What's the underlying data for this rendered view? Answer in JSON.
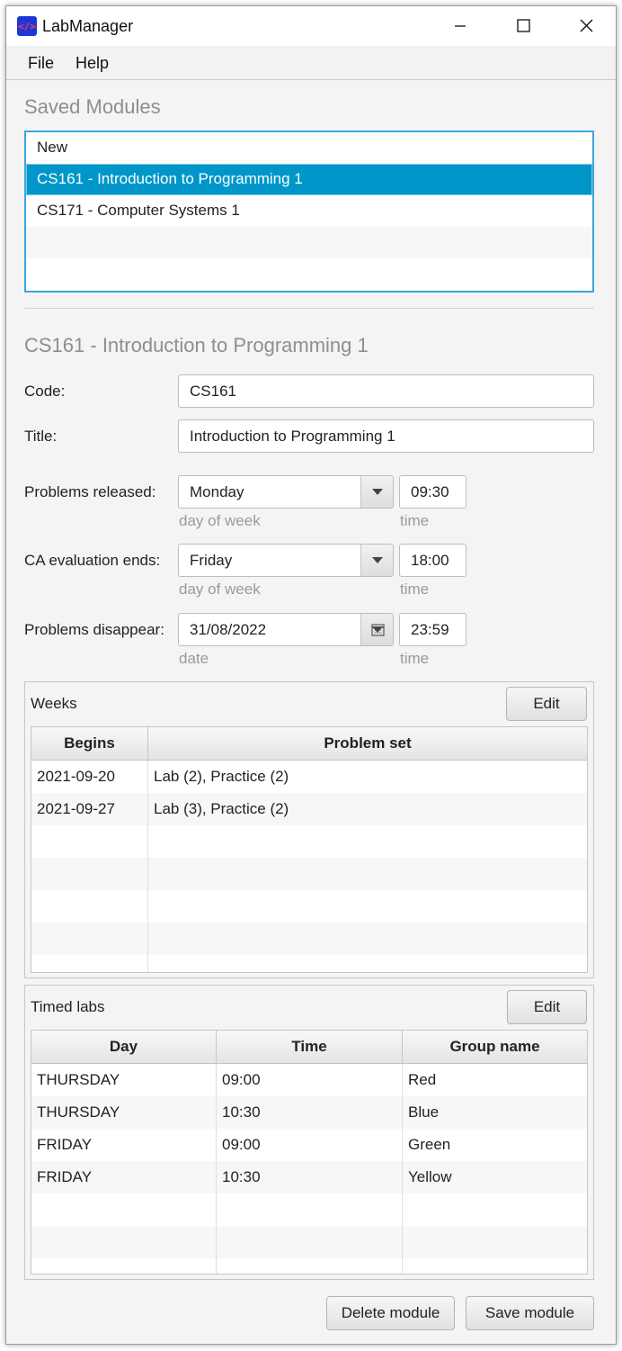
{
  "window": {
    "title": "LabManager",
    "app_icon": "code-brackets-icon"
  },
  "menu": {
    "items": [
      "File",
      "Help"
    ]
  },
  "saved_modules": {
    "heading": "Saved Modules",
    "items": [
      "New",
      "CS161 - Introduction to Programming 1",
      "CS171 - Computer Systems 1",
      "",
      ""
    ],
    "selected_index": 1
  },
  "module": {
    "heading": "CS161 - Introduction to Programming 1",
    "code_label": "Code:",
    "code_value": "CS161",
    "title_label": "Title:",
    "title_value": "Introduction to Programming 1",
    "released_label": "Problems released:",
    "released_day": "Monday",
    "released_time": "09:30",
    "ca_label": "CA evaluation ends:",
    "ca_day": "Friday",
    "ca_time": "18:00",
    "disappear_label": "Problems disappear:",
    "disappear_date": "31/08/2022",
    "disappear_time": "23:59",
    "hint_day": "day of week",
    "hint_time": "time",
    "hint_date": "date"
  },
  "weeks": {
    "title": "Weeks",
    "edit_label": "Edit",
    "columns": [
      "Begins",
      "Problem set"
    ],
    "rows": [
      [
        "2021-09-20",
        "Lab (2), Practice (2)"
      ],
      [
        "2021-09-27",
        "Lab (3), Practice (2)"
      ],
      [
        "",
        ""
      ],
      [
        "",
        ""
      ],
      [
        "",
        ""
      ],
      [
        "",
        ""
      ],
      [
        "",
        ""
      ]
    ]
  },
  "timed_labs": {
    "title": "Timed labs",
    "edit_label": "Edit",
    "columns": [
      "Day",
      "Time",
      "Group name"
    ],
    "rows": [
      [
        "THURSDAY",
        "09:00",
        "Red"
      ],
      [
        "THURSDAY",
        "10:30",
        "Blue"
      ],
      [
        "FRIDAY",
        "09:00",
        "Green"
      ],
      [
        "FRIDAY",
        "10:30",
        "Yellow"
      ],
      [
        "",
        "",
        ""
      ],
      [
        "",
        "",
        ""
      ],
      [
        "",
        "",
        ""
      ]
    ]
  },
  "footer": {
    "delete_label": "Delete module",
    "save_label": "Save module"
  },
  "colors": {
    "selection": "#0096c9",
    "focus_border": "#3ea5e0"
  }
}
